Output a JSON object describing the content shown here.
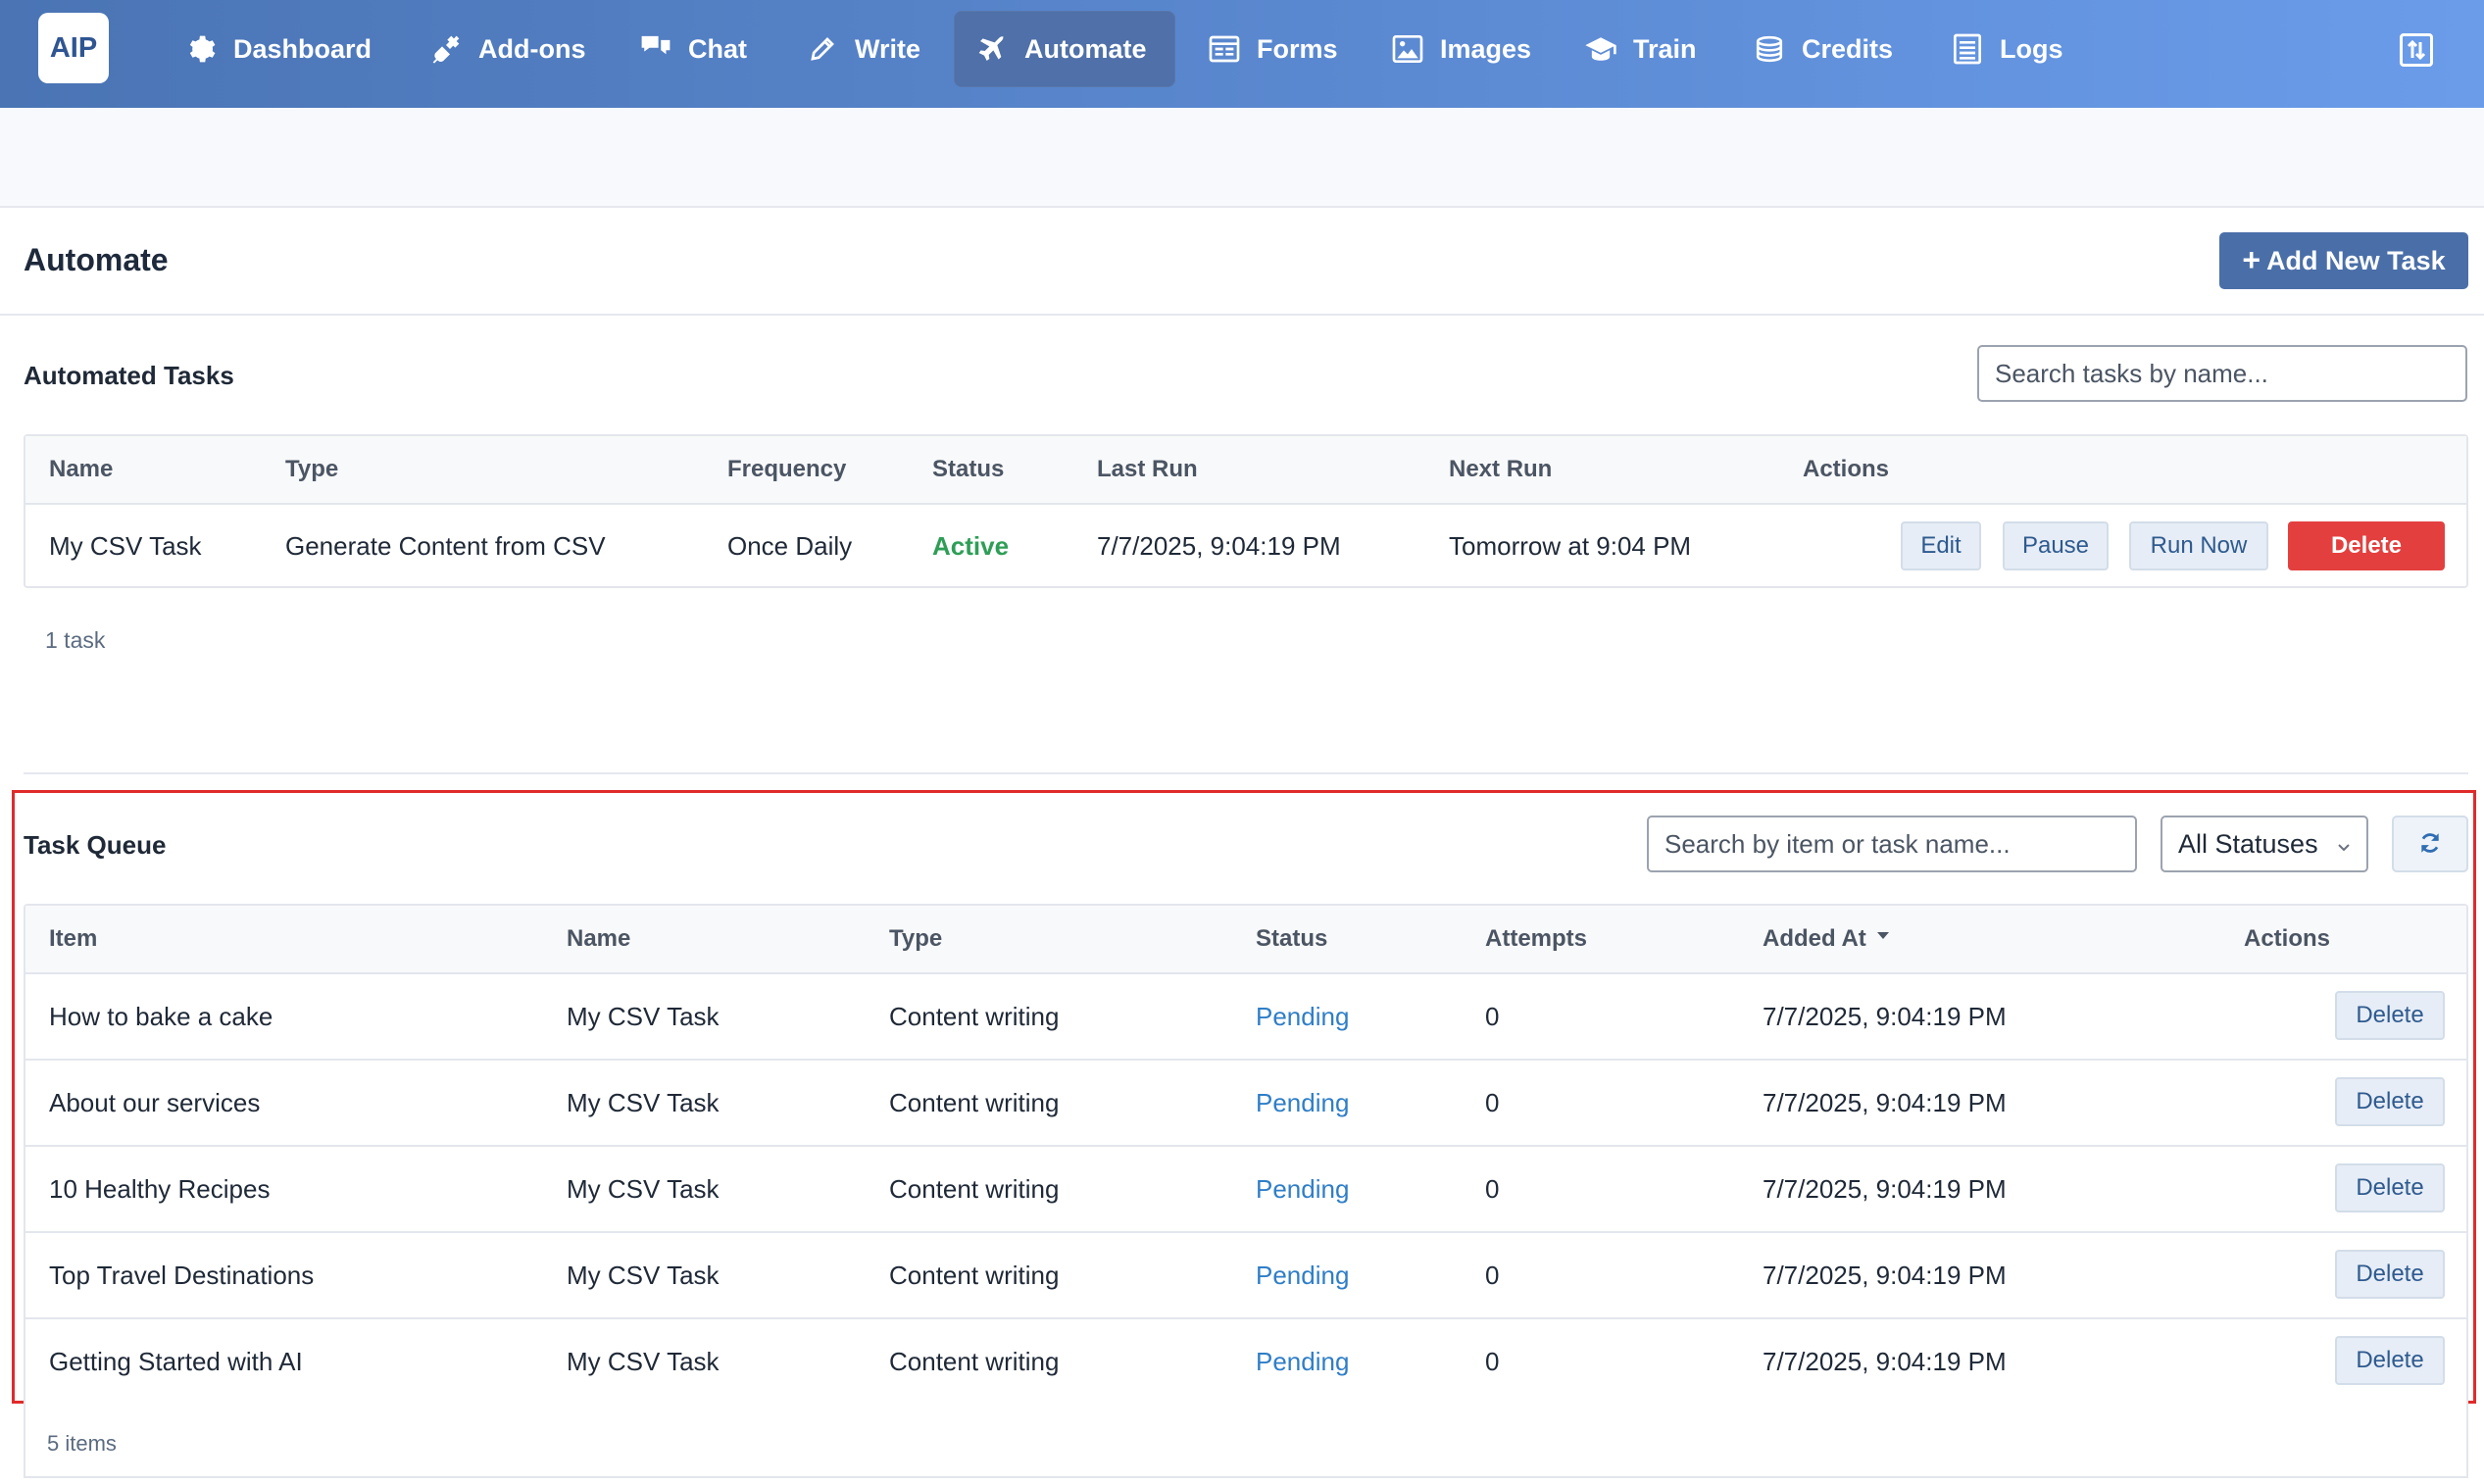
{
  "app": {
    "logo_text": "AIP"
  },
  "nav": [
    {
      "label": "Dashboard",
      "icon": "gear-icon"
    },
    {
      "label": "Add-ons",
      "icon": "plug-icon"
    },
    {
      "label": "Chat",
      "icon": "chat-bubbles-icon"
    },
    {
      "label": "Write",
      "icon": "pencil-icon"
    },
    {
      "label": "Automate",
      "icon": "plane-icon",
      "active": true
    },
    {
      "label": "Forms",
      "icon": "form-icon"
    },
    {
      "label": "Images",
      "icon": "image-icon"
    },
    {
      "label": "Train",
      "icon": "graduation-cap-icon"
    },
    {
      "label": "Credits",
      "icon": "coins-icon"
    },
    {
      "label": "Logs",
      "icon": "list-icon"
    }
  ],
  "header": {
    "title": "Automate",
    "add_button": "Add New Task"
  },
  "tasks": {
    "title": "Automated Tasks",
    "search_placeholder": "Search tasks by name...",
    "columns": [
      "Name",
      "Type",
      "Frequency",
      "Status",
      "Last Run",
      "Next Run",
      "Actions"
    ],
    "rows": [
      {
        "name": "My CSV Task",
        "type": "Generate Content from CSV",
        "frequency": "Once Daily",
        "status": "Active",
        "last_run": "7/7/2025, 9:04:19 PM",
        "next_run": "Tomorrow at 9:04 PM"
      }
    ],
    "actions": {
      "edit": "Edit",
      "pause": "Pause",
      "run_now": "Run Now",
      "delete": "Delete"
    },
    "count": "1 task"
  },
  "queue": {
    "title": "Task Queue",
    "search_placeholder": "Search by item or task name...",
    "status_filter": "All Statuses",
    "columns": [
      "Item",
      "Name",
      "Type",
      "Status",
      "Attempts",
      "Added At",
      "Actions"
    ],
    "rows": [
      {
        "item": "How to bake a cake",
        "name": "My CSV Task",
        "type": "Content writing",
        "status": "Pending",
        "attempts": "0",
        "added_at": "7/7/2025, 9:04:19 PM"
      },
      {
        "item": "About our services",
        "name": "My CSV Task",
        "type": "Content writing",
        "status": "Pending",
        "attempts": "0",
        "added_at": "7/7/2025, 9:04:19 PM"
      },
      {
        "item": "10 Healthy Recipes",
        "name": "My CSV Task",
        "type": "Content writing",
        "status": "Pending",
        "attempts": "0",
        "added_at": "7/7/2025, 9:04:19 PM"
      },
      {
        "item": "Top Travel Destinations",
        "name": "My CSV Task",
        "type": "Content writing",
        "status": "Pending",
        "attempts": "0",
        "added_at": "7/7/2025, 9:04:19 PM"
      },
      {
        "item": "Getting Started with AI",
        "name": "My CSV Task",
        "type": "Content writing",
        "status": "Pending",
        "attempts": "0",
        "added_at": "7/7/2025, 9:04:19 PM"
      }
    ],
    "delete_label": "Delete",
    "count": "5 items"
  }
}
